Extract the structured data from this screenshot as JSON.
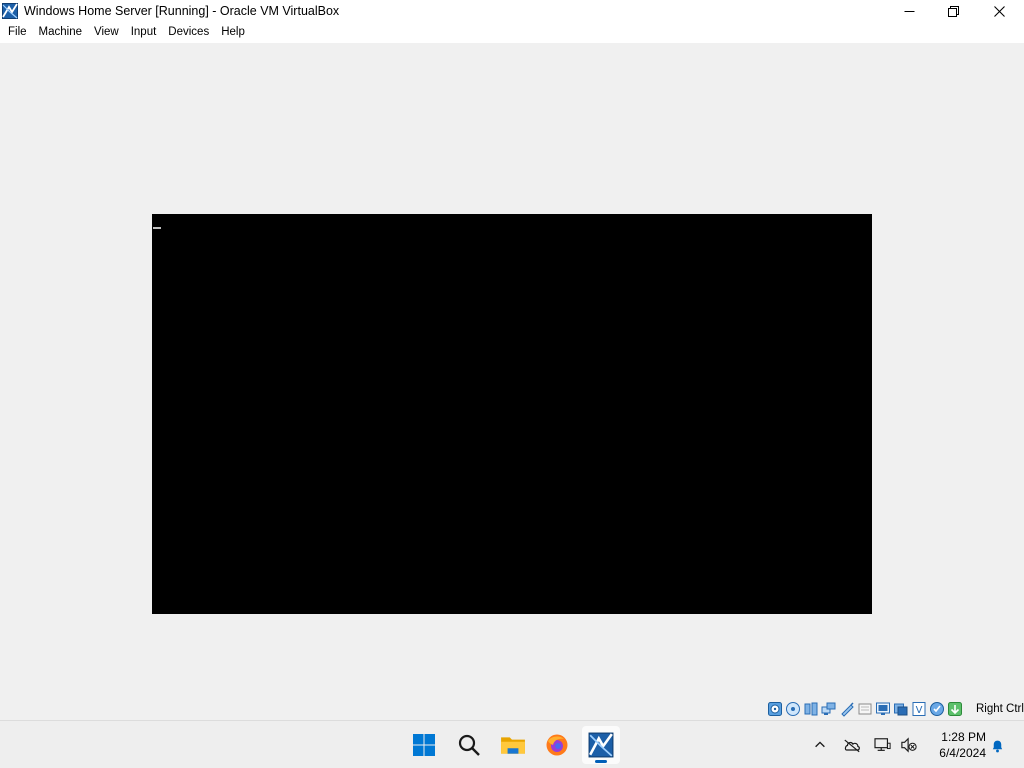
{
  "window": {
    "title": "Windows Home Server [Running] - Oracle VM VirtualBox",
    "app_icon": "virtualbox-icon",
    "controls": [
      "minimize-icon",
      "maximize-icon",
      "close-icon"
    ]
  },
  "menu": {
    "items": [
      {
        "label": "File"
      },
      {
        "label": "Machine"
      },
      {
        "label": "View"
      },
      {
        "label": "Input"
      },
      {
        "label": "Devices"
      },
      {
        "label": "Help"
      }
    ]
  },
  "vm": {
    "screen_color": "#000000",
    "cursor_color": "#c0c0c0"
  },
  "statusbar": {
    "icons": [
      "hard-disk-icon",
      "optical-drive-icon",
      "audio-icon",
      "network-icon",
      "usb-icon",
      "shared-folders-icon",
      "display-icon",
      "video-capture-icon",
      "virtualization-icon",
      "mouse-integration-icon",
      "keyboard-capture-icon"
    ],
    "host_key": "Right Ctrl"
  },
  "taskbar": {
    "apps": [
      "start-icon",
      "search-icon",
      "file-explorer-icon",
      "firefox-icon",
      "virtualbox-icon"
    ],
    "active_app": "virtualbox-icon",
    "tray_icons": [
      "chevron-up-icon",
      "onedrive-icon",
      "network-icon",
      "volume-icon",
      "notification-bell-icon"
    ],
    "clock": {
      "time": "1:28 PM",
      "date": "6/4/2024"
    }
  }
}
